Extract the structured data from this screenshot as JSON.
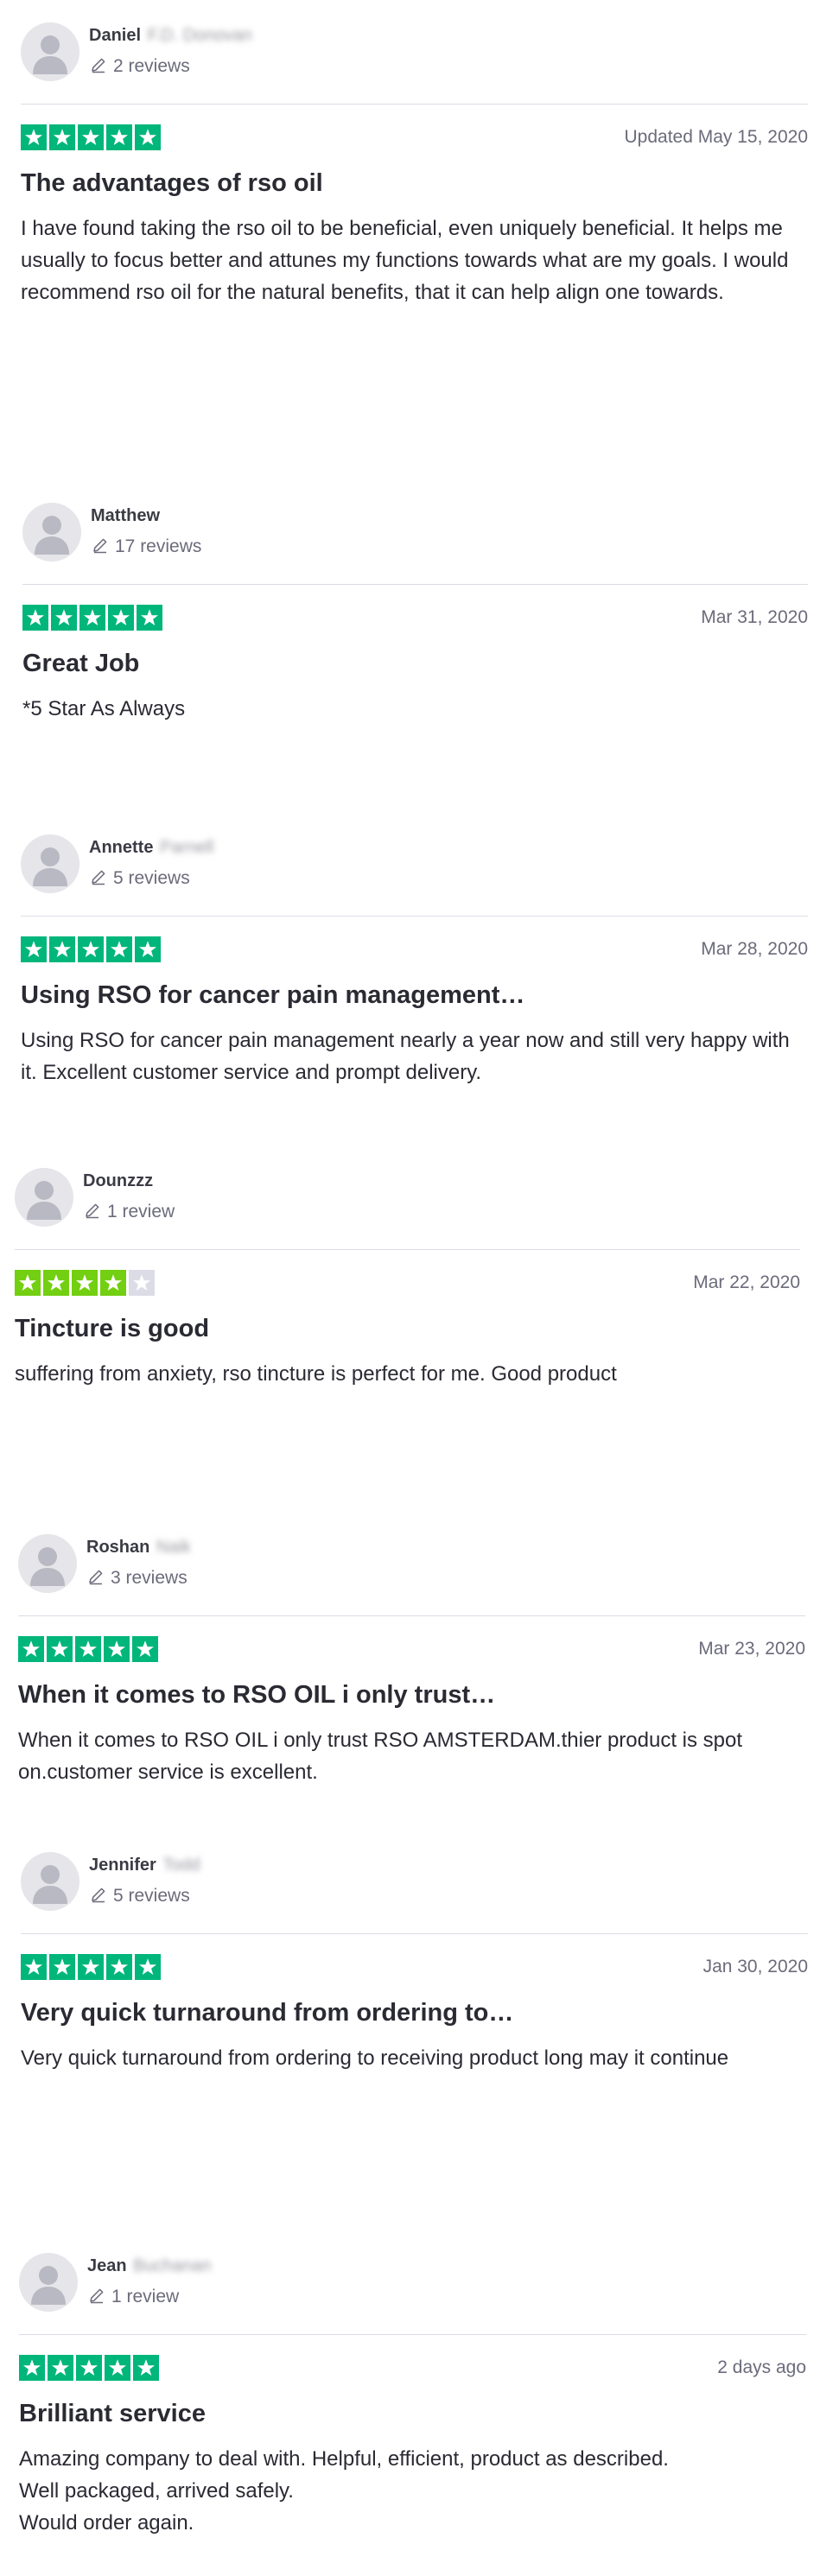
{
  "colors": {
    "star_green": "#00b67a",
    "star_lime": "#73cf11",
    "star_empty": "#dcdce6"
  },
  "reviews": [
    {
      "first_name": "Daniel",
      "surname_blurred": "F.D. Donovan",
      "review_count": "2 reviews",
      "rating": 5,
      "date": "Updated May 15, 2020",
      "title": "The advantages of rso oil",
      "body": [
        "I have found taking the rso oil to be beneficial, even uniquely beneficial. It helps me usually to focus better and attunes my functions towards what are my goals. I would recommend rso oil for the natural benefits, that it can help align one towards."
      ]
    },
    {
      "first_name": "Matthew",
      "surname_blurred": "",
      "review_count": "17 reviews",
      "rating": 5,
      "date": "Mar 31, 2020",
      "title": "Great Job",
      "body": [
        "*5 Star As Always"
      ]
    },
    {
      "first_name": "Annette",
      "surname_blurred": "Parnell",
      "review_count": "5 reviews",
      "rating": 5,
      "date": "Mar 28, 2020",
      "title": "Using RSO for cancer pain management…",
      "body": [
        "Using RSO for cancer pain management nearly a year now and still very happy with it. Excellent customer service and prompt delivery."
      ]
    },
    {
      "first_name": "Dounzzz",
      "surname_blurred": "",
      "review_count": "1 review",
      "rating": 4,
      "date": "Mar 22, 2020",
      "title": "Tincture is good",
      "body": [
        "suffering from anxiety, rso tincture is perfect for me. Good product"
      ]
    },
    {
      "first_name": "Roshan",
      "surname_blurred": "Naik",
      "review_count": "3 reviews",
      "rating": 5,
      "date": "Mar 23, 2020",
      "title": "When it comes to RSO OIL i only trust…",
      "body": [
        "When it comes to RSO OIL i only trust RSO AMSTERDAM.thier product is spot on.customer service is excellent."
      ]
    },
    {
      "first_name": "Jennifer",
      "surname_blurred": "Todd",
      "review_count": "5 reviews",
      "rating": 5,
      "date": "Jan 30, 2020",
      "title": "Very quick turnaround from ordering to…",
      "body": [
        "Very quick turnaround from ordering to receiving product long may it continue"
      ]
    },
    {
      "first_name": "Jean",
      "surname_blurred": "Buchanan",
      "review_count": "1 review",
      "rating": 5,
      "date": "2 days ago",
      "title": "Brilliant service",
      "body": [
        "Amazing company to deal with. Helpful, efficient, product as described.",
        "Well packaged, arrived safely.",
        "Would order again."
      ]
    }
  ]
}
